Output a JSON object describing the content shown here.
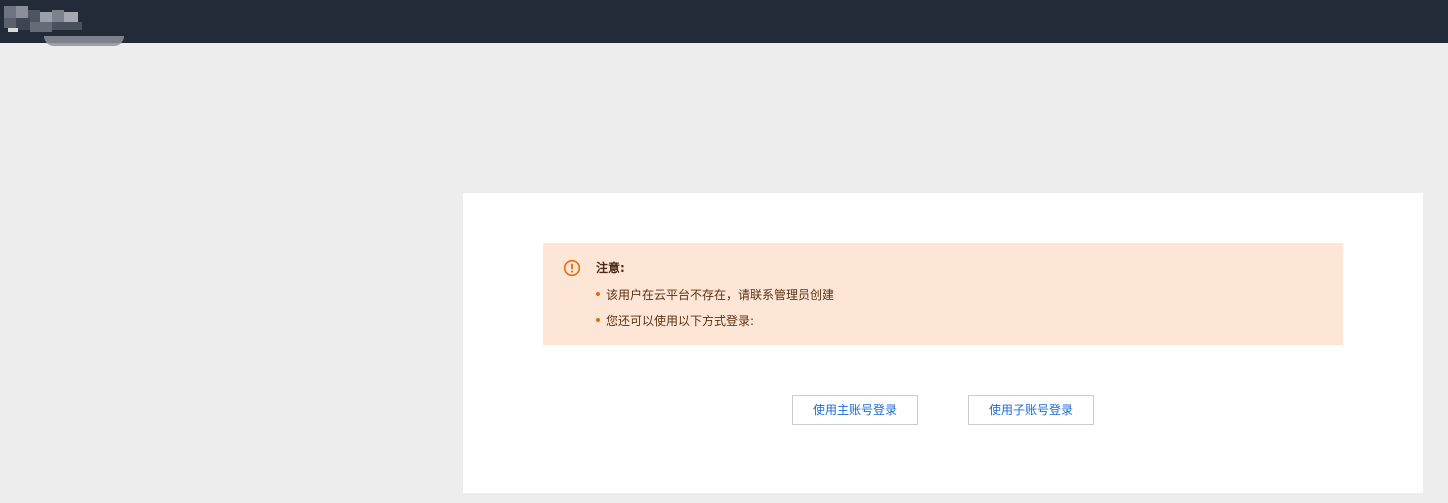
{
  "header": {
    "logo_icon": "blurred-logo",
    "background_color": "#232b39"
  },
  "notice": {
    "icon": "warning-circle-icon",
    "icon_color": "#e66a0c",
    "title": "注意:",
    "items": [
      "该用户在云平台不存在，请联系管理员创建",
      "您还可以使用以下方式登录:"
    ],
    "background_color": "#fee6d7"
  },
  "actions": {
    "main_account_login": "使用主账号登录",
    "sub_account_login": "使用子账号登录",
    "link_color": "#1a6bd6"
  }
}
